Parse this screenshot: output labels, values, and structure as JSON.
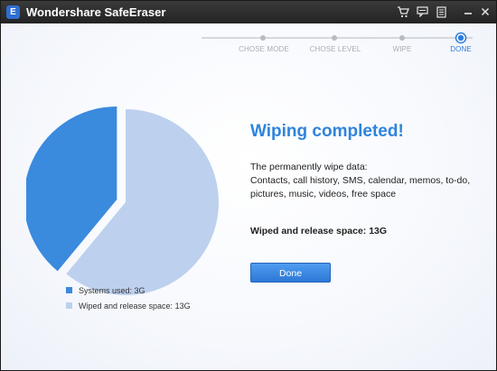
{
  "window": {
    "title": "Wondershare SafeEraser",
    "logo_letter": "E",
    "toolbar_icons": [
      "cart-icon",
      "feedback-icon",
      "register-icon",
      "minimize-icon",
      "close-icon"
    ]
  },
  "steps": [
    {
      "label": "CHOSE MODE",
      "state": "completed"
    },
    {
      "label": "CHOSE LEVEL",
      "state": "completed"
    },
    {
      "label": "WIPE",
      "state": "completed"
    },
    {
      "label": "DONE",
      "state": "current"
    }
  ],
  "result": {
    "heading": "Wiping completed!",
    "description_lines": [
      "The permanently wipe data:",
      "Contacts, call history, SMS, calendar, memos, to-do,",
      "pictures, music, videos, free space"
    ],
    "space_text": "Wiped and release space: 13G",
    "done_label": "Done"
  },
  "legend": [
    {
      "label": "Systems used: 3G",
      "color": "#3a8ade"
    },
    {
      "label": "Wiped and release space: 13G",
      "color": "#bdd0ee"
    }
  ],
  "chart_data": {
    "type": "pie",
    "slices": [
      {
        "label": "Systems used: 3G",
        "value": 3,
        "color": "#3a8ade",
        "exploded": true
      },
      {
        "label": "Wiped and release space: 13G",
        "value": 13,
        "color": "#bdd0ee",
        "exploded": false
      }
    ],
    "note": "Visible pie proportions appear larger than 3/16 for the systems slice",
    "visible_fraction_systems": 0.39
  },
  "colors": {
    "accent": "#2f84dc",
    "titlebar": "#2a2a2a",
    "step_inactive": "#a9adb3"
  }
}
